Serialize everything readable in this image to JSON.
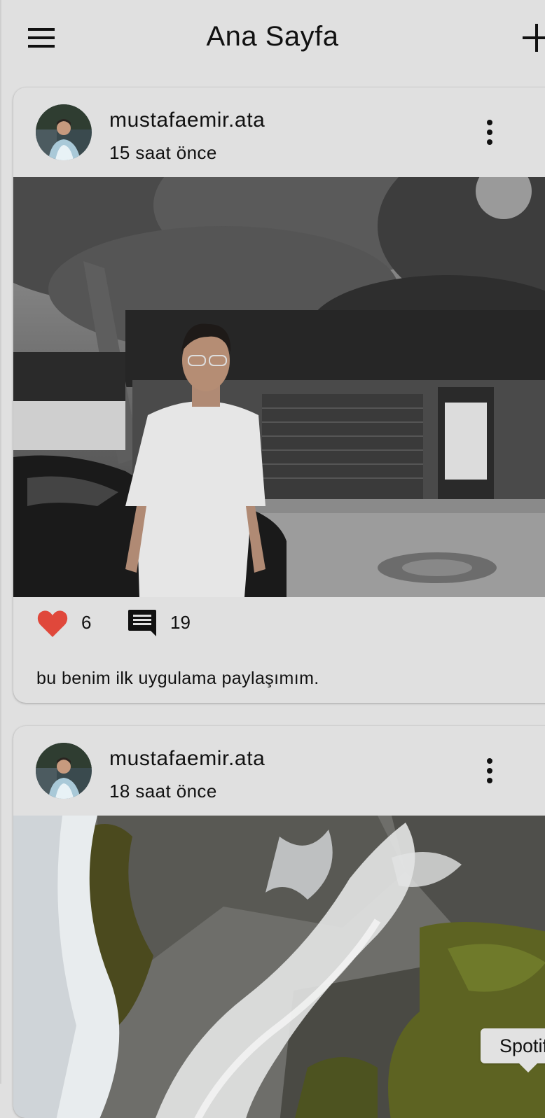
{
  "appbar": {
    "title": "Ana Sayfa",
    "menu_icon": "hamburger-menu-icon",
    "add_icon": "plus-icon"
  },
  "posts": [
    {
      "username": "mustafaemir.ata",
      "time_ago": "15 saat önce",
      "image": "grayscale-photo-man-white-tshirt-street",
      "likes": "6",
      "comments": "19",
      "caption": "bu benim ilk uygulama paylaşımım."
    },
    {
      "username": "mustafaemir.ata",
      "time_ago": "18 saat önce",
      "image": "waterfall-mossy-rocks-photo"
    }
  ],
  "tooltip": {
    "text": "Spotify"
  },
  "colors": {
    "background": "#e0e0e0",
    "like_heart": "#e0483b",
    "text": "#111111"
  }
}
